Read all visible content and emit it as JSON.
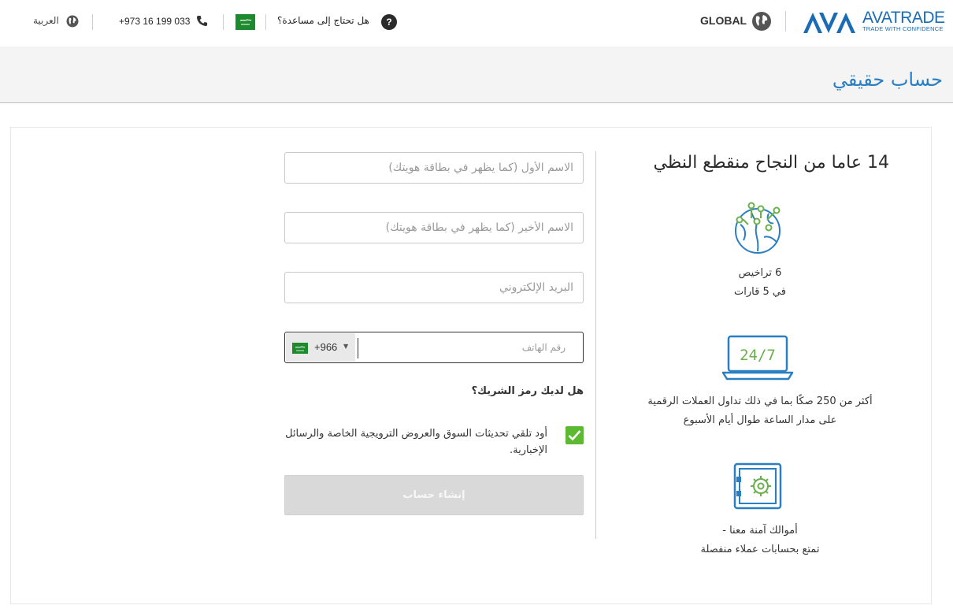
{
  "header": {
    "brand_name": "AVATRADE",
    "brand_tagline": "TRADE WITH CONFIDENCE",
    "region_label": "GLOBAL",
    "region_icon": "globe-icon",
    "help_text": "هل تحتاج إلى مساعدة؟",
    "help_icon_glyph": "?",
    "country_flag": "saudi-flag-icon",
    "phone_number": "+973 16 199 033",
    "phone_icon": "phone-icon",
    "language_label": "العربية",
    "language_icon": "globe-icon"
  },
  "banner": {
    "title": "حساب حقيقي"
  },
  "features": {
    "headline": "14 عاما من النجاح منقطع النظي",
    "items": [
      {
        "icon": "global-network-icon",
        "line1": "6 تراخيص",
        "line2": "في 5 قارات"
      },
      {
        "icon": "laptop-24-7-icon",
        "icon_text": "24/7",
        "line1": "أكثر من 250 صكًا بما في ذلك تداول العملات الرقمية",
        "line2": "على مدار الساعة طوال أيام الأسبوع"
      },
      {
        "icon": "safe-vault-icon",
        "line1": "أموالك آمنة معنا -",
        "line2": "تمتع بحسابات عملاء منفصلة"
      }
    ]
  },
  "form": {
    "first_name_placeholder": "الاسم الأول (كما يظهر في بطاقة هويتك)",
    "last_name_placeholder": "الاسم الأخير (كما يظهر في بطاقة هويتك)",
    "email_placeholder": "البريد الإلكتروني",
    "country_code": "+966",
    "phone_placeholder": "رقم الهاتف",
    "partner_question": "هل لديك رمز الشريك؟",
    "marketing_checkbox_label": "أود تلقي تحديثات السوق والعروض الترويجية الخاصة والرسائل الإخبارية.",
    "marketing_checked": true,
    "submit_label": "إنشاء حساب"
  },
  "colors": {
    "brand_blue": "#1a6cb4",
    "title_blue": "#2a7ec2",
    "checkbox_green": "#5db832",
    "flag_green": "#1e8a2e",
    "disabled_button": "#d9d9d9"
  }
}
